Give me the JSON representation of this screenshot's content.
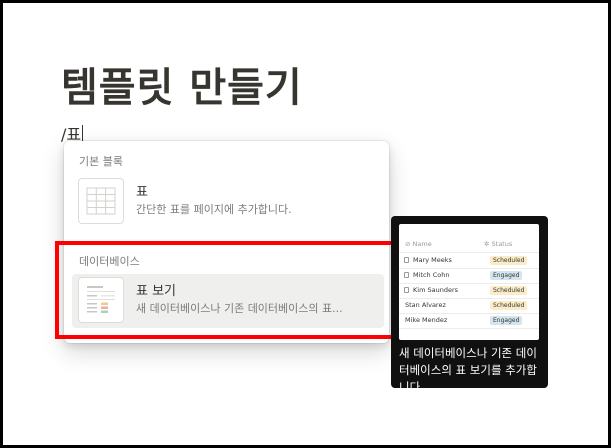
{
  "page": {
    "title": "템플릿 만들기",
    "slash_input": "/표"
  },
  "menu": {
    "sections": [
      {
        "header": "기본 블록",
        "items": [
          {
            "title": "표",
            "description": "간단한 표를 페이지에 추가합니다."
          }
        ]
      },
      {
        "header": "데이터베이스",
        "items": [
          {
            "title": "표 보기",
            "description": "새 데이터베이스나 기존 데이터베이스의 표...",
            "selected": true
          }
        ]
      }
    ]
  },
  "preview": {
    "columns": [
      "Name",
      "Status"
    ],
    "rows": [
      {
        "name": "Mary Meeks",
        "status": "Scheduled"
      },
      {
        "name": "Mitch Cohn",
        "status": "Engaged"
      },
      {
        "name": "Kim Saunders",
        "status": "Scheduled"
      },
      {
        "name": "Stan Alvarez",
        "status": "Scheduled"
      },
      {
        "name": "Mike Mendez",
        "status": "Engaged"
      }
    ],
    "description": "새 데이터베이스나 기존 데이터베이스의 표 보기를 추가합니다."
  },
  "colors": {
    "highlight": "#ff0000",
    "scheduled": "#fbecc8",
    "engaged": "#d3e5ef"
  }
}
